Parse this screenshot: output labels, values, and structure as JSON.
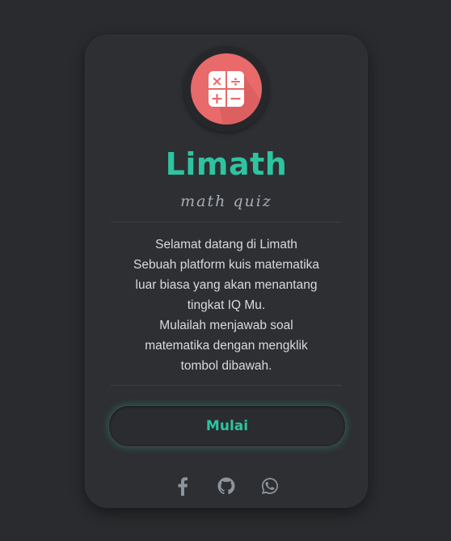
{
  "app": {
    "title": "Limath",
    "subtitle": "math quiz"
  },
  "logo": {
    "icon": "calculator-icon",
    "symbols": [
      "×",
      "÷",
      "+",
      "−"
    ],
    "color": "#e86a6a"
  },
  "description": {
    "lines": [
      "Selamat datang di Limath",
      "Sebuah platform kuis matematika",
      "luar biasa yang akan menantang",
      "tingkat IQ Mu.",
      "Mulailah menjawab soal",
      "matematika dengan mengklik",
      "tombol dibawah."
    ]
  },
  "start_button": {
    "label": "Mulai"
  },
  "socials": [
    {
      "name": "facebook-icon"
    },
    {
      "name": "github-icon"
    },
    {
      "name": "whatsapp-icon"
    }
  ],
  "colors": {
    "accent": "#2ec4a0",
    "card": "#2d2f33",
    "background": "#2a2b2e",
    "icon": "#8e949c"
  }
}
